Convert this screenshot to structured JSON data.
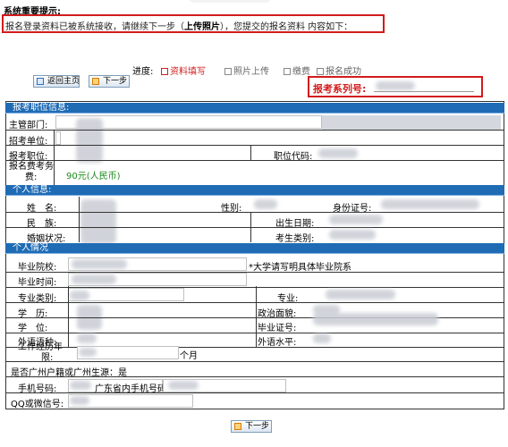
{
  "notice": {
    "title": "系统重要提示:",
    "text_main": "报名登录资料已被系统接收，请继续下一步（",
    "text_bold": "上传照片",
    "text_tail": "），您提交的报名资料 内容如下："
  },
  "progress": {
    "label": "进度:",
    "steps": [
      {
        "label": "资料填写",
        "checked": true
      },
      {
        "label": "照片上传",
        "checked": false
      },
      {
        "label": "缴费",
        "checked": false
      },
      {
        "label": "报名成功",
        "checked": false
      }
    ]
  },
  "nav": {
    "home_label": "返回主页",
    "next_label": "下一步"
  },
  "registration": {
    "label": "报考系列号:"
  },
  "sections": {
    "position": {
      "title": "报考职位信息:",
      "department_label": "主管部门:",
      "unit_label": "招考单位:",
      "position_label": "报考职位:",
      "position_code_label": "职位代码:",
      "fee_label_line1": "报名费考务",
      "fee_label_line2": "费:",
      "fee_value": "90元(人民币)"
    },
    "personal": {
      "title": "个人信息:",
      "name_label": "姓　名:",
      "gender_label": "性别:",
      "id_label": "身份证号:",
      "ethnicity_label": "民　族:",
      "birthdate_label": "出生日期:",
      "marital_label": "婚姻状况:",
      "examinee_type_label": "考生类别:"
    },
    "situation": {
      "title": "个人情况",
      "school_label": "毕业院校:",
      "school_note": "*大学请写明具体毕业院系",
      "grad_time_label": "毕业时间:",
      "major_category_label": "专业类别:",
      "major_label": "专业:",
      "education_label": "学　历:",
      "political_label": "政治面貌:",
      "degree_label": "学　位:",
      "diploma_label": "毕业证号:",
      "language_label": "外语语种:",
      "language_level_label": "外语水平:",
      "work_years_line1": "工作经历年",
      "work_years_line2": "限:",
      "work_years_unit": "个月",
      "hukou_question": "是否广州户籍或广州生源：是",
      "phone_label": "手机号码:",
      "phone_note": "广东省内手机号码",
      "qq_label": "QQ或微信号:"
    }
  },
  "footer": {
    "next_label": "下一步"
  }
}
